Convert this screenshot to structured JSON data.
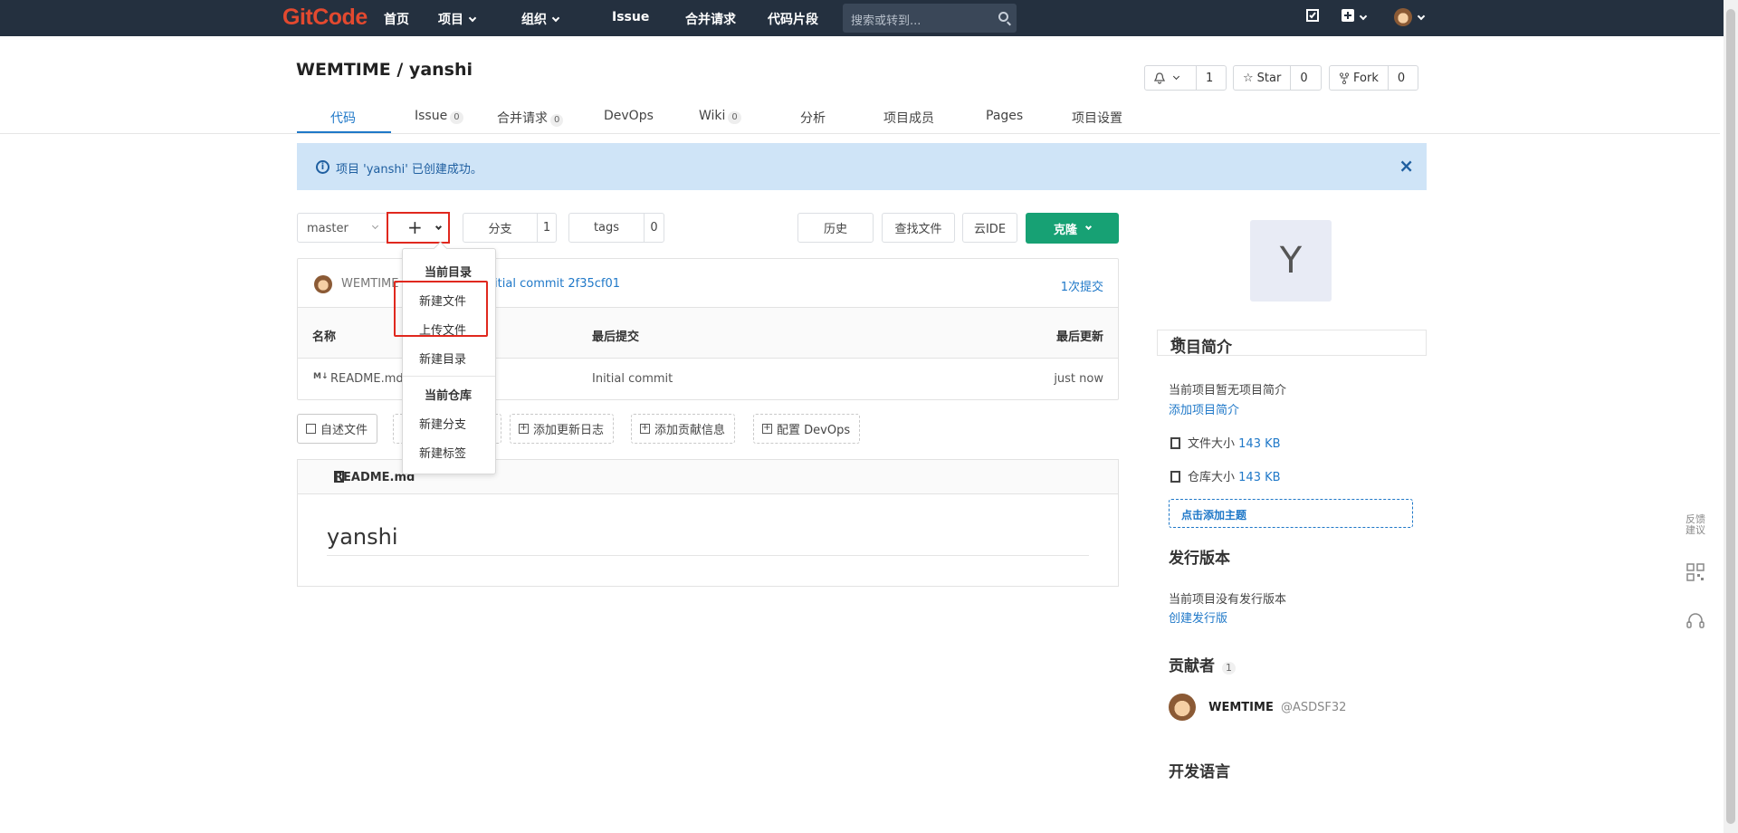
{
  "nav": {
    "logo": "GitCode",
    "home": "首页",
    "projects": "项目",
    "groups": "组织",
    "issue": "Issue",
    "merge_requests": "合并请求",
    "snippets": "代码片段",
    "search_placeholder": "搜索或转到..."
  },
  "repo": {
    "title": "WEMTIME / yanshi",
    "watch_count": "1",
    "star_label": "Star",
    "star_count": "0",
    "fork_label": "Fork",
    "fork_count": "0"
  },
  "tabs": [
    {
      "label": "代码"
    },
    {
      "label": "Issue",
      "badge": "0"
    },
    {
      "label": "合并请求",
      "badge": "0"
    },
    {
      "label": "DevOps"
    },
    {
      "label": "Wiki",
      "badge": "0"
    },
    {
      "label": "分析"
    },
    {
      "label": "项目成员"
    },
    {
      "label": "Pages"
    },
    {
      "label": "项目设置"
    }
  ],
  "flash": {
    "message": "项目 'yanshi' 已创建成功。",
    "close": "×"
  },
  "toolbar": {
    "branch": "master",
    "plus": "+",
    "branches_label": "分支",
    "branches_count": "1",
    "tags_label": "tags",
    "tags_count": "0",
    "history": "历史",
    "find_file": "查找文件",
    "cloud_ide": "云IDE",
    "clone": "克隆"
  },
  "commit": {
    "author": "WEMTIME",
    "message": "Initial commit 2f35cf01",
    "count": "1次提交"
  },
  "file_table": {
    "headers": {
      "name": "名称",
      "last_commit": "最后提交",
      "last_update": "最后更新"
    },
    "rows": [
      {
        "icon": "M↓",
        "name": "README.md",
        "commit": "Initial commit",
        "updated": "just now"
      }
    ]
  },
  "action_buttons": {
    "readme": "自述文件",
    "changelog": "添加更新日志",
    "contributing": "添加贡献信息",
    "devops": "配置 DevOps"
  },
  "dropdown": {
    "section_dir": "当前目录",
    "new_file": "新建文件",
    "upload_file": "上传文件",
    "new_dir": "新建目录",
    "section_repo": "当前仓库",
    "new_branch": "新建分支",
    "new_tag": "新建标签"
  },
  "readme": {
    "filename": "README.md",
    "heading": "yanshi"
  },
  "sidebar": {
    "avatar_letter": "Y",
    "intro_title": "项目简介",
    "no_desc": "当前项目暂无项目简介",
    "add_desc": "添加项目简介",
    "file_size_label": "文件大小",
    "file_size": "143 KB",
    "repo_size_label": "仓库大小",
    "repo_size": "143 KB",
    "add_topic": "点击添加主题",
    "releases_title": "发行版本",
    "no_releases": "当前项目没有发行版本",
    "create_release": "创建发行版",
    "contributors_title": "贡献者",
    "contributors_count": "1",
    "contributor_name": "WEMTIME",
    "contributor_handle": "@ASDSF32",
    "languages_title": "开发语言"
  },
  "float": {
    "feedback": "反馈建议"
  }
}
